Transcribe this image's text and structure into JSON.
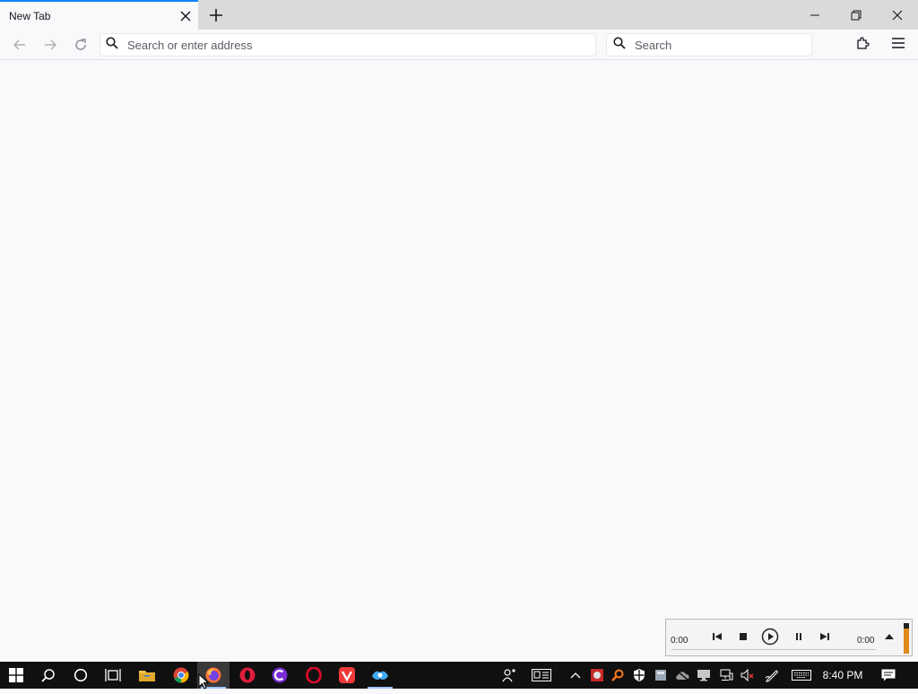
{
  "browser": {
    "tab": {
      "title": "New Tab",
      "active": true
    },
    "urlbar": {
      "placeholder": "Search or enter address",
      "value": ""
    },
    "searchbar": {
      "placeholder": "Search",
      "value": ""
    },
    "accent_color": "#0a84ff"
  },
  "media_player": {
    "elapsed": "0:00",
    "duration": "0:00",
    "controls": [
      "previous-icon",
      "stop-icon",
      "play-icon",
      "pause-icon",
      "next-icon",
      "expand-icon"
    ]
  },
  "taskbar": {
    "pinned": [
      "windows-start-icon",
      "search-icon",
      "cortana-icon",
      "task-view-icon",
      "file-explorer-icon",
      "chrome-icon",
      "firefox-icon",
      "opera-gx-icon",
      "ccleaner-icon",
      "opera-icon",
      "vivaldi-icon",
      "waterfox-icon"
    ],
    "tray_icons": [
      "people-icon",
      "news-icon",
      "show-hidden-icons-chevron",
      "antivirus-icon",
      "search-tool-icon",
      "defender-icon",
      "disk-icon",
      "cloud-icon",
      "display-icon",
      "network-icon",
      "volume-muted-icon",
      "pen-icon",
      "keyboard-icon"
    ],
    "clock": "8:40 PM",
    "notifications": "action-center-icon"
  }
}
